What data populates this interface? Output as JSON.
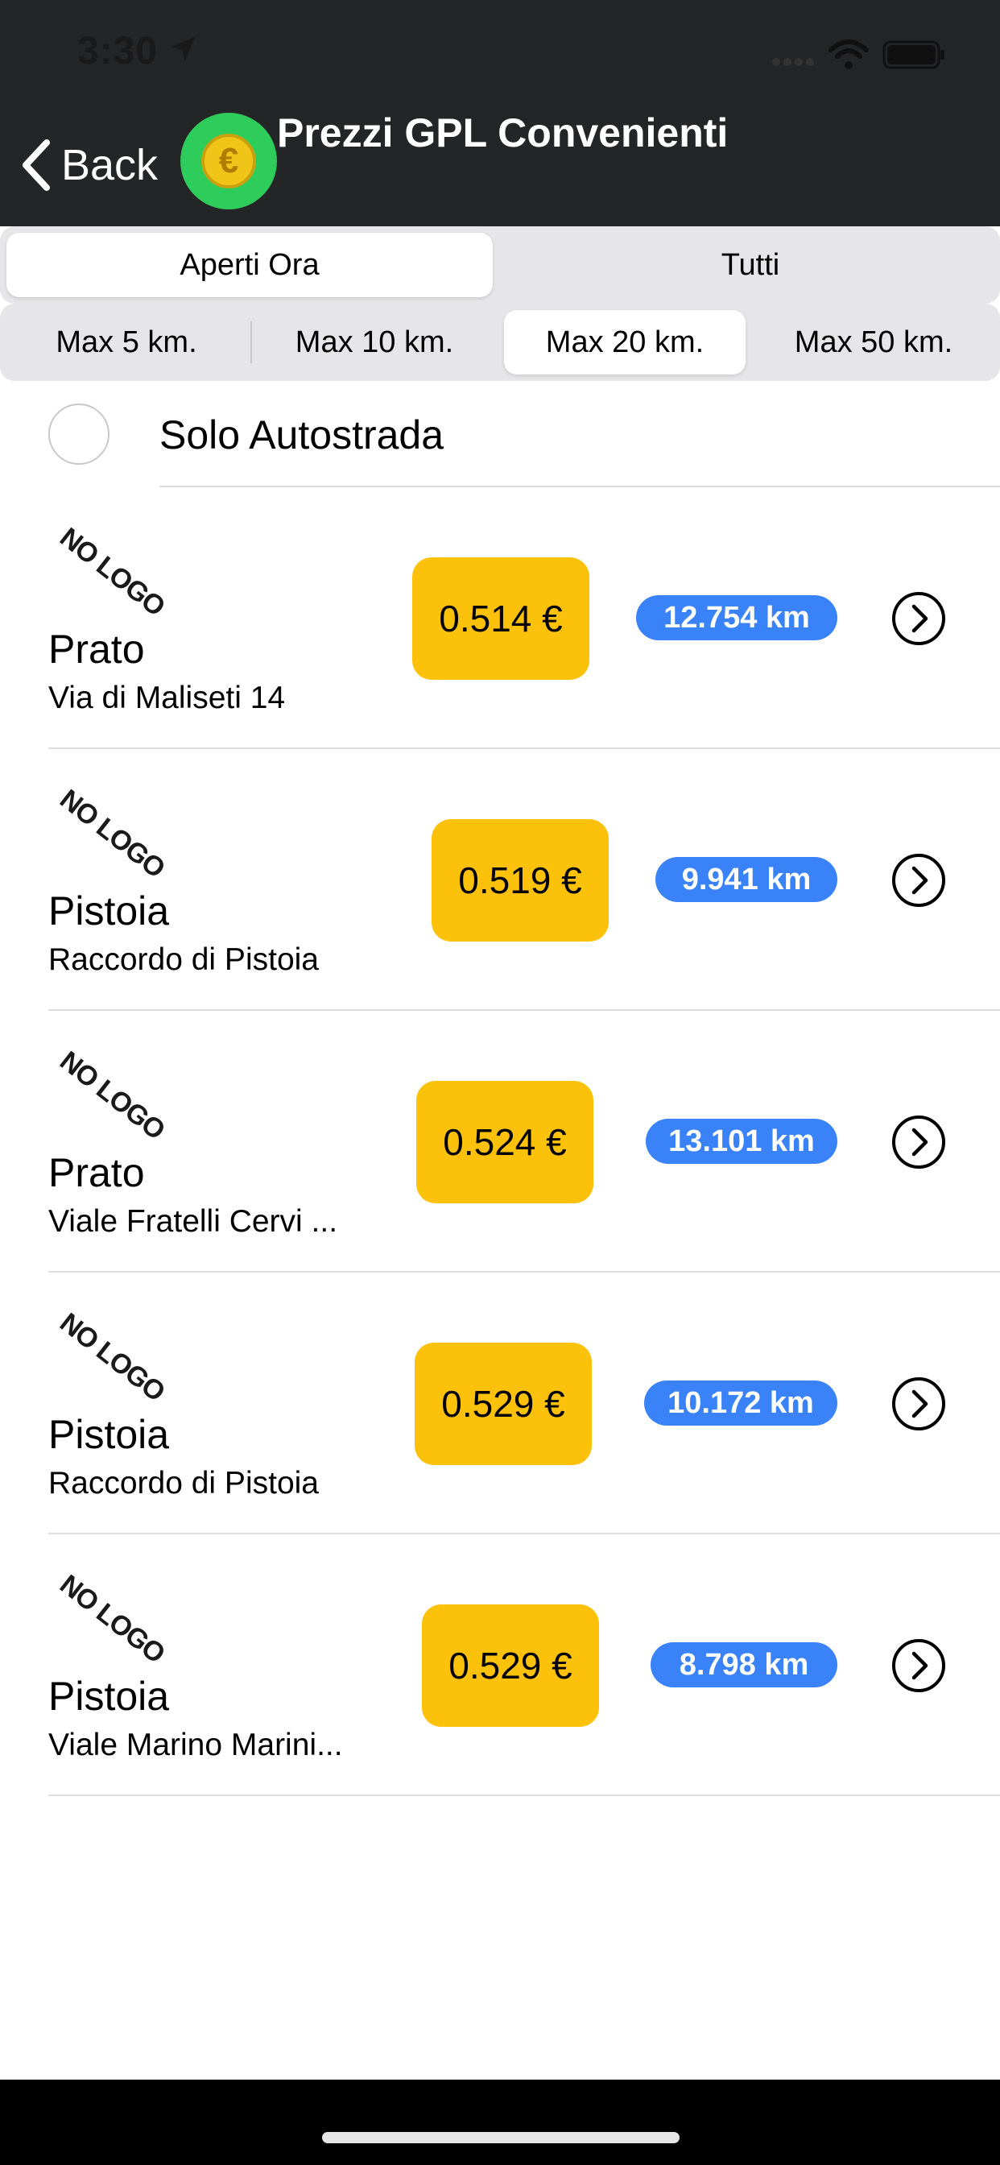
{
  "status_bar": {
    "time": "3:30"
  },
  "nav": {
    "back_label": "Back",
    "title": "Prezzi GPL Convenienti",
    "logo_symbol": "€"
  },
  "filter_status": {
    "options": [
      "Aperti Ora",
      "Tutti"
    ],
    "selected": "Aperti Ora"
  },
  "filter_distance": {
    "options": [
      "Max 5 km.",
      "Max 10 km.",
      "Max 20 km.",
      "Max 50 km."
    ],
    "selected": "Max 20 km."
  },
  "solo_autostrada": {
    "label": "Solo Autostrada",
    "checked": false
  },
  "stations": [
    {
      "logo_text": "NO LOGO",
      "city": "Prato",
      "address": "Via di Maliseti 14",
      "price": "0.514 €",
      "distance": "12.754 km"
    },
    {
      "logo_text": "NO LOGO",
      "city": "Pistoia",
      "address": "Raccordo di Pistoia",
      "price": "0.519 €",
      "distance": "9.941 km"
    },
    {
      "logo_text": "NO LOGO",
      "city": "Prato",
      "address": "Viale Fratelli Cervi ...",
      "price": "0.524 €",
      "distance": "13.101 km"
    },
    {
      "logo_text": "NO LOGO",
      "city": "Pistoia",
      "address": "Raccordo di Pistoia",
      "price": "0.529 €",
      "distance": "10.172 km"
    },
    {
      "logo_text": "NO LOGO",
      "city": "Pistoia",
      "address": "Viale Marino Marini...",
      "price": "0.529 €",
      "distance": "8.798 km"
    }
  ],
  "colors": {
    "header_bg": "#242527",
    "price_bg": "#fcc20b",
    "distance_bg": "#3a82f7",
    "logo_bg": "#2ecc5a"
  }
}
